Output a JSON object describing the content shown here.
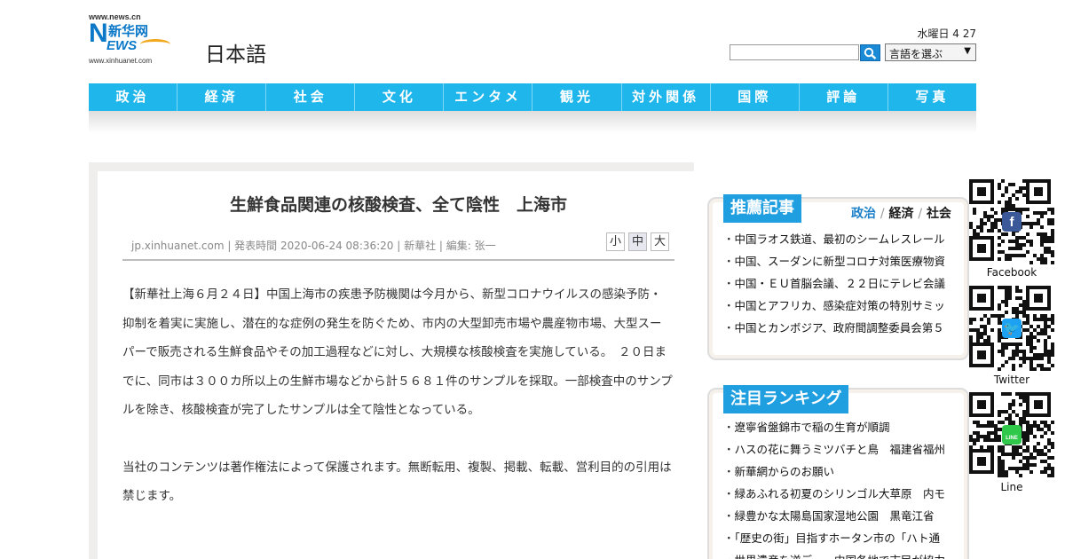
{
  "header": {
    "logo_url_top": "www.news.cn",
    "logo_cn": "新华网",
    "logo_n": "N",
    "logo_ews": "EWS",
    "logo_url_bottom": "www.xinhuanet.com",
    "site_language": "日本語",
    "date": "水曜日 4  27",
    "search_placeholder": "",
    "language_select": "言語を選ぶ"
  },
  "nav": {
    "items": [
      "政治",
      "経済",
      "社会",
      "文化",
      "エンタメ",
      "観光",
      "対外関係",
      "国際",
      "評論",
      "写真"
    ]
  },
  "article": {
    "title": "生鮮食品関連の核酸検査、全て陰性　上海市",
    "meta": "jp.xinhuanet.com | 発表時間 2020-06-24 08:36:20 | 新華社 | 編集: 张一",
    "font_sizes": [
      "小",
      "中",
      "大"
    ],
    "paragraphs": [
      "【新華社上海６月２４日】中国上海市の疾患予防機関は今月から、新型コロナウイルスの感染予防・抑制を着実に実施し、潜在的な症例の発生を防ぐため、市内の大型卸売市場や農産物市場、大型スーパーで販売される生鮮食品やその加工過程などに対し、大規模な核酸検査を実施している。　２０日までに、同市は３００カ所以上の生鮮市場などから計５６８１件のサンプルを採取。一部検査中のサンプルを除き、核酸検査が完了したサンプルは全て陰性となっている。",
      "当社のコンテンツは著作権法によって保護されます。無断転用、複製、掲載、転載、営利目的の引用は禁じます。"
    ]
  },
  "recommended": {
    "heading": "推薦記事",
    "cat_1": "政治",
    "cat_2": "経済",
    "cat_3": "社会",
    "separator": "/",
    "items": [
      "中国ラオス鉄道、最初のシームレスレール",
      "中国、スーダンに新型コロナ対策医療物資",
      "中国・ＥＵ首脳会議、２２日にテレビ会議",
      "中国とアフリカ、感染症対策の特別サミッ",
      "中国とカンボジア、政府間調整委員会第５"
    ]
  },
  "ranking": {
    "heading": "注目ランキング",
    "items": [
      "遼寧省盤錦市で稲の生育が順調",
      "ハスの花に舞うミツバチと鳥　福建省福州",
      "新華網からのお願い",
      "緑あふれる初夏のシリンゴル大草原　内モ",
      "緑豊かな太陽島国家湿地公園　黒竜江省",
      "「歴史の街」目指すホータン市の「ハト通",
      "世界遺産を逆デー　中国各地で市民が協力"
    ]
  },
  "social": {
    "facebook": "Facebook",
    "twitter": "Twitter",
    "line": "Line"
  },
  "colors": {
    "nav_bg": "#1fb6ec",
    "box_head_bg": "#1f9ee0",
    "logo_blue": "#0b78c8",
    "logo_orange": "#f2a81d"
  }
}
